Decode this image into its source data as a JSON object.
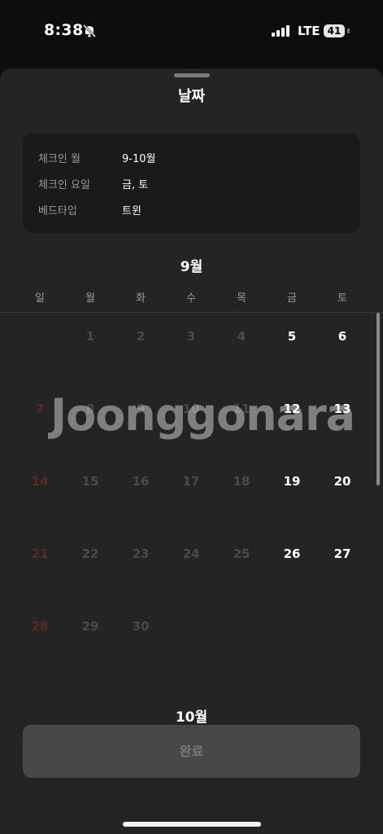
{
  "status_bar": {
    "time": "8:38",
    "network": "LTE",
    "battery": "41"
  },
  "sheet": {
    "title": "날짜"
  },
  "summary": [
    {
      "label": "체크인 월",
      "value": "9-10월"
    },
    {
      "label": "체크인 요일",
      "value": "금, 토"
    },
    {
      "label": "베드타입",
      "value": "트윈"
    }
  ],
  "weekdays": [
    "일",
    "월",
    "화",
    "수",
    "목",
    "금",
    "토"
  ],
  "september": {
    "title": "9월",
    "weeks": [
      [
        null,
        "1",
        "2",
        "3",
        "4",
        "5",
        "6"
      ],
      [
        "7",
        "8",
        "9",
        "10",
        "11",
        "12",
        "13"
      ],
      [
        "14",
        "15",
        "16",
        "17",
        "18",
        "19",
        "20"
      ],
      [
        "21",
        "22",
        "23",
        "24",
        "25",
        "26",
        "27"
      ],
      [
        "28",
        "29",
        "30",
        null,
        null,
        null,
        null
      ]
    ]
  },
  "october": {
    "title": "10월"
  },
  "done_button": "완료",
  "watermark": "Joonggonara"
}
